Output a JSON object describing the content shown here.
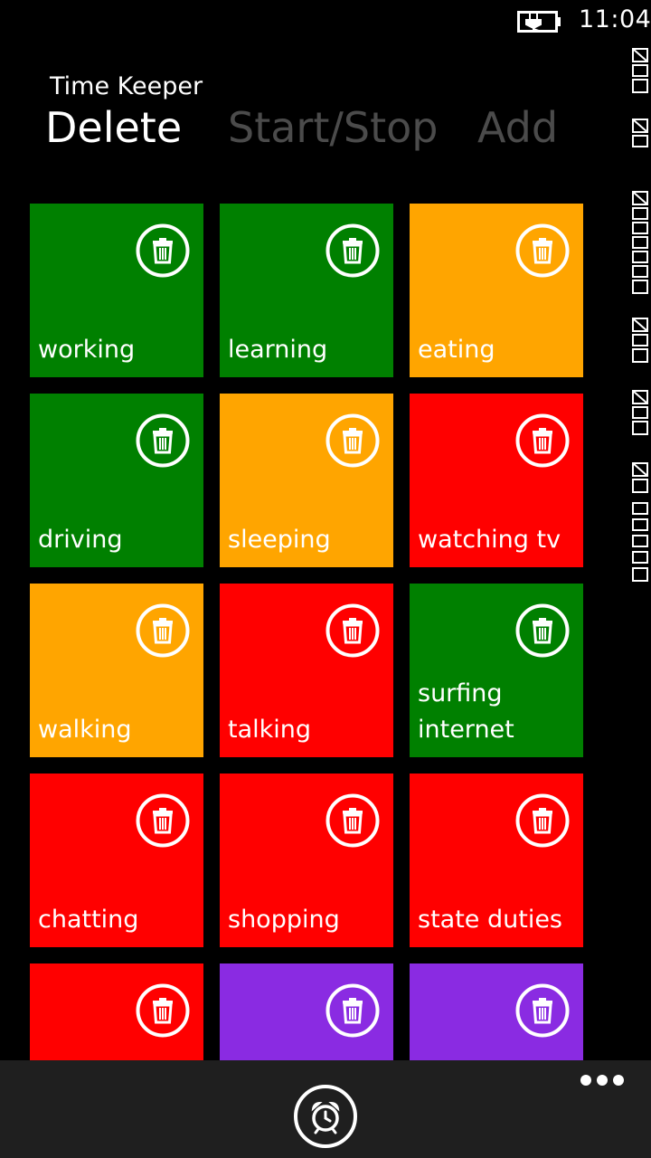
{
  "status_bar": {
    "time": "11:04",
    "icons": [
      "battery-charging-icon"
    ]
  },
  "app": {
    "title": "Time Keeper"
  },
  "pivot": {
    "items": [
      {
        "label": "Delete",
        "active": true
      },
      {
        "label": "Start/Stop",
        "active": false
      },
      {
        "label": "Add",
        "active": false
      }
    ]
  },
  "tiles": [
    {
      "label": "working",
      "color": "#008000"
    },
    {
      "label": "learning",
      "color": "#008000"
    },
    {
      "label": "eating",
      "color": "#FFA500"
    },
    {
      "label": "driving",
      "color": "#008000"
    },
    {
      "label": "sleeping",
      "color": "#FFA500"
    },
    {
      "label": "watching tv",
      "color": "#FF0000"
    },
    {
      "label": "walking",
      "color": "#FFA500"
    },
    {
      "label": "talking",
      "color": "#FF0000"
    },
    {
      "label": "surfing internet",
      "color": "#008000"
    },
    {
      "label": "chatting",
      "color": "#FF0000"
    },
    {
      "label": "shopping",
      "color": "#FF0000"
    },
    {
      "label": "state duties",
      "color": "#FF0000"
    },
    {
      "label": "",
      "color": "#FF0000"
    },
    {
      "label": "",
      "color": "#8A2BE2"
    },
    {
      "label": "",
      "color": "#8A2BE2"
    }
  ],
  "tile_action_icon": "trash-icon",
  "app_bar": {
    "buttons": [
      {
        "icon": "alarm-clock-icon"
      }
    ],
    "more_icon": "ellipsis-icon"
  }
}
